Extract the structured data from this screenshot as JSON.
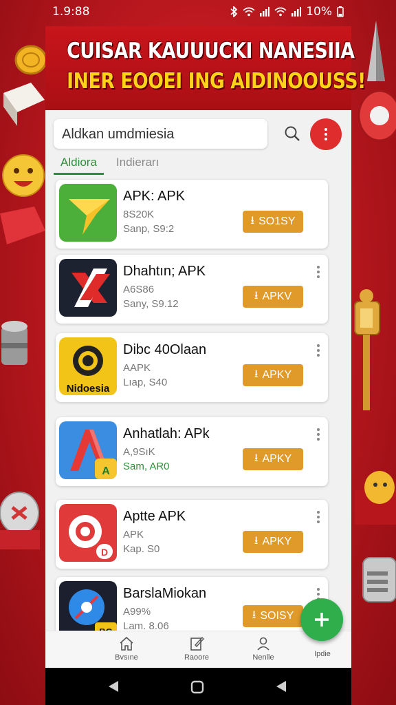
{
  "status": {
    "time": "1.9:88",
    "battery": "10%"
  },
  "banner": {
    "line1": "CUISAR KAUUUCKI NANESIIA",
    "line2": "INER EOOEI  ING AIDINOOUSS!"
  },
  "search": {
    "value": "Aldkan umdmiesia"
  },
  "tabs": [
    {
      "label": "Aldiora",
      "active": true
    },
    {
      "label": "Indierarı",
      "active": false
    }
  ],
  "apps": [
    {
      "name": "APK: APK",
      "size": "8S20K",
      "meta": "Sanp, S9:2",
      "button": "SO1SY",
      "icon": "star-arrow-icon",
      "color": "#4caf3a"
    },
    {
      "name": "Dhahtın; APK",
      "size": "A6S86",
      "meta": "Sany, S9.12",
      "button": "APKV",
      "icon": "red-x-icon",
      "color": "#1d2230"
    },
    {
      "name": "Dibc 40Olaan",
      "size": "AAPK",
      "meta": "Lıap, S40",
      "button": "APKY",
      "icon": "nidoesia-badge-icon",
      "color": "#f2c418"
    },
    {
      "name": "Anhatlah: APk",
      "size": "A,9SıK",
      "meta": "Sam, AR0",
      "button": "APKY",
      "icon": "blue-a-icon",
      "color": "#3a8de0"
    },
    {
      "name": "Aptte APK",
      "size": "APK",
      "meta": "Kap. S0",
      "button": "APKY",
      "icon": "red-camera-icon",
      "color": "#e03a3a"
    },
    {
      "name": "BarslaMiokan",
      "size": "A99%",
      "meta": "Lam. 8.06",
      "button": "SOISY",
      "icon": "blue-dish-icon",
      "color": "#1b1f2e"
    }
  ],
  "bottom_nav": [
    {
      "label": "Bvsıne",
      "icon": "home-icon"
    },
    {
      "label": "Raoore",
      "icon": "notes-icon"
    },
    {
      "label": "Nenlle",
      "icon": "person-icon"
    },
    {
      "label": "Ipdie",
      "icon": "fab-add-icon"
    }
  ],
  "colors": {
    "accent": "#e09a2a",
    "fab": "#2fae4b",
    "menu": "#df2c2c",
    "tab_active": "#2e8f3a",
    "background": "#c8151b"
  }
}
